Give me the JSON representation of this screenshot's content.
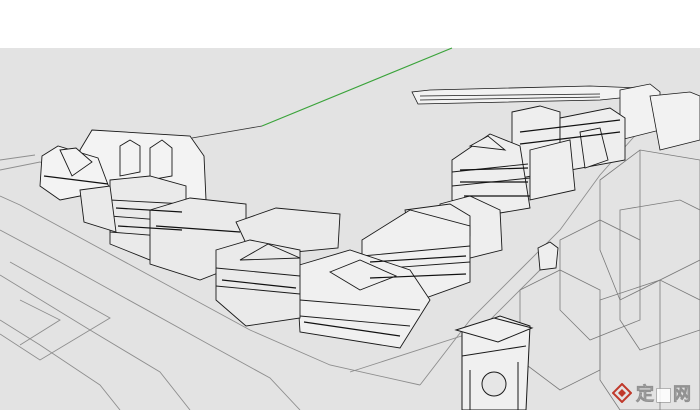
{
  "scene": {
    "description_free": true,
    "sky_color": "#ffffff",
    "ground_color": "#e3e3e3",
    "line_color": "#1a1a1a",
    "axis_green": "#3aa33a",
    "ground_line_color": "#9a9a9a"
  },
  "watermark": {
    "icon": "diamond-logo-icon",
    "text": "定■网"
  }
}
